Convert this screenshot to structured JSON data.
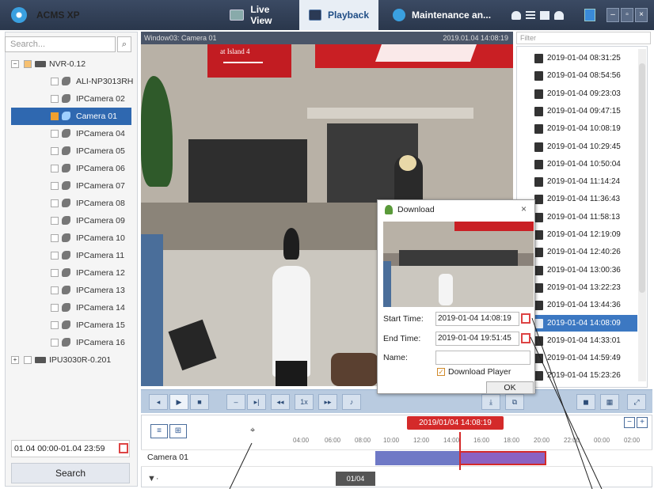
{
  "titlebar": {
    "app_title": "ACMS XP",
    "tabs": [
      {
        "label": "Live View",
        "active": false
      },
      {
        "label": "Playback",
        "active": true
      },
      {
        "label": "Maintenance an...",
        "active": false
      }
    ]
  },
  "left_panel": {
    "search_placeholder": "Search...",
    "tree": [
      {
        "label": "NVR-0.12",
        "type": "nvr",
        "expanded": true
      },
      {
        "label": "ALI-NP3013RH",
        "type": "camera"
      },
      {
        "label": "IPCamera 02",
        "type": "camera"
      },
      {
        "label": "Camera 01",
        "type": "camera",
        "selected": true,
        "checked": true
      },
      {
        "label": "IPCamera 04",
        "type": "camera"
      },
      {
        "label": "IPCamera 05",
        "type": "camera"
      },
      {
        "label": "IPCamera 06",
        "type": "camera"
      },
      {
        "label": "IPCamera 07",
        "type": "camera"
      },
      {
        "label": "IPCamera 08",
        "type": "camera"
      },
      {
        "label": "IPCamera 09",
        "type": "camera"
      },
      {
        "label": "IPCamera 10",
        "type": "camera"
      },
      {
        "label": "IPCamera 11",
        "type": "camera"
      },
      {
        "label": "IPCamera 12",
        "type": "camera"
      },
      {
        "label": "IPCamera 13",
        "type": "camera"
      },
      {
        "label": "IPCamera 14",
        "type": "camera"
      },
      {
        "label": "IPCamera 15",
        "type": "camera"
      },
      {
        "label": "IPCamera 16",
        "type": "camera"
      },
      {
        "label": "IPU3030R-0.201",
        "type": "nvr",
        "expanded": false
      }
    ],
    "time_range": "01.04 00:00-01.04 23:59",
    "search_button": "Search"
  },
  "video": {
    "window_label": "Window03: Camera 01",
    "timestamp": "2019.01.04 14:08:19",
    "sign_text": "at Island 4"
  },
  "recordings": {
    "filter_placeholder": "Filter",
    "items": [
      "2019-01-04 08:31:25",
      "2019-01-04 08:54:56",
      "2019-01-04 09:23:03",
      "2019-01-04 09:47:15",
      "2019-01-04 10:08:19",
      "2019-01-04 10:29:45",
      "2019-01-04 10:50:04",
      "2019-01-04 11:14:24",
      "2019-01-04 11:36:43",
      "2019-01-04 11:58:13",
      "2019-01-04 12:19:09",
      "2019-01-04 12:40:26",
      "2019-01-04 13:00:36",
      "2019-01-04 13:22:23",
      "2019-01-04 13:44:36",
      "2019-01-04 14:08:09",
      "2019-01-04 14:33:01",
      "2019-01-04 14:59:49",
      "2019-01-04 15:23:26"
    ],
    "selected_index": 15
  },
  "controls": {
    "speed": "1x"
  },
  "timeline": {
    "current_time": "2019/01/04 14:08:19",
    "ticks": [
      "04:00",
      "06:00",
      "08:00",
      "10:00",
      "12:00",
      "14:00",
      "16:00",
      "18:00",
      "20:00",
      "22:00",
      "00:00",
      "02:00"
    ],
    "camera_label": "Camera 01",
    "date_chip": "01/04",
    "zoom_minus": "−",
    "zoom_plus": "+"
  },
  "dialog": {
    "title": "Download",
    "close": "×",
    "start_label": "Start Time:",
    "start_value": "2019-01-04 14:08:19",
    "end_label": "End Time:",
    "end_value": "2019-01-04 19:51:45",
    "name_label": "Name:",
    "name_value": "",
    "checkbox_label": "Download Player",
    "ok": "OK"
  }
}
